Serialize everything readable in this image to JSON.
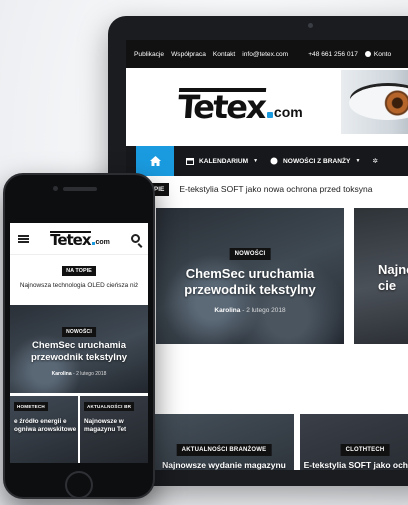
{
  "laptop": {
    "topbar": {
      "links": [
        "Publikacje",
        "Współpraca",
        "Kontakt"
      ],
      "email": "info@tetex.com",
      "phone": "+48 661 256 017",
      "account": "Konto"
    },
    "logo": {
      "brand": "Tetex",
      "tld": "com"
    },
    "nav": {
      "items": [
        "KALENDARIUM",
        "NOWOŚCI Z BRANŻY"
      ]
    },
    "ticker": {
      "badge": "NA TOPIE",
      "headline": "E-tekstylia SOFT jako nowa ochrona przed toksyna"
    },
    "tiles": {
      "main": {
        "category": "NOWOŚCI",
        "title": "ChemSec uruchamia przewodnik tekstylny",
        "author": "Karolina",
        "date": "2 lutego 2018"
      },
      "right": {
        "title": "Najno cie"
      },
      "bottom1": {
        "category": "AKTUALNOŚCI BRANŻOWE",
        "title": "Najnowsze wydanie magazynu Tetex już jest!"
      },
      "bottom2": {
        "category": "CLOTHTECH",
        "title": "E-tekstylia SOFT jako ochrona przed toksy"
      }
    }
  },
  "phone": {
    "logo": {
      "brand": "Tetex",
      "tld": "com"
    },
    "ticker": {
      "badge": "NA TOPIE",
      "headline": "Najnowsza technologia OLED cieńsza niż"
    },
    "tiles": {
      "main": {
        "category": "NOWOŚCI",
        "title": "ChemSec uruchamia przewodnik tekstylny",
        "author": "Karolina",
        "date": "2 lutego 2018"
      },
      "b1": {
        "category": "HOMETECH",
        "title": "e źródło energii e ogniwa arowskitowe"
      },
      "b2": {
        "category": "AKTUALNOŚCI BR",
        "title": "Najnowsze w magazynu Tet"
      }
    }
  },
  "colors": {
    "accent": "#1a9be0",
    "dark": "#111111"
  }
}
